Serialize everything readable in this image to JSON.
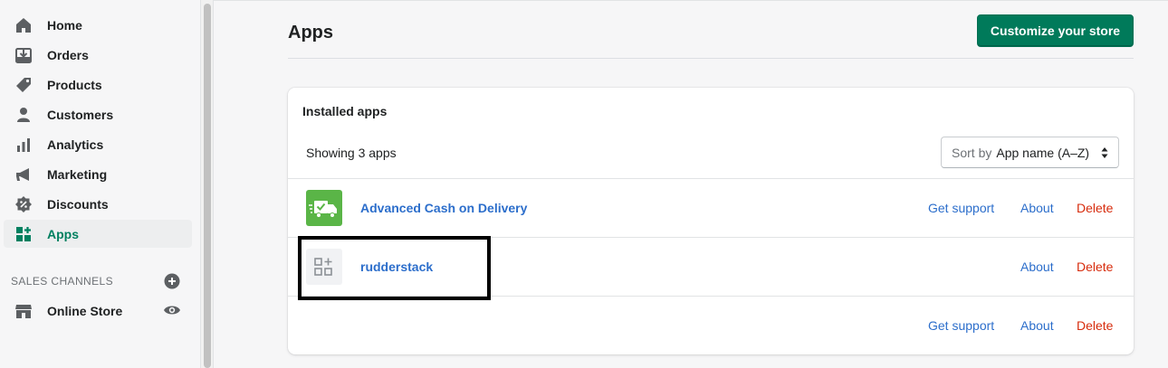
{
  "sidebar": {
    "items": [
      {
        "label": "Home",
        "icon": "home-icon"
      },
      {
        "label": "Orders",
        "icon": "orders-icon"
      },
      {
        "label": "Products",
        "icon": "tag-icon"
      },
      {
        "label": "Customers",
        "icon": "person-icon"
      },
      {
        "label": "Analytics",
        "icon": "bar-chart-icon"
      },
      {
        "label": "Marketing",
        "icon": "megaphone-icon"
      },
      {
        "label": "Discounts",
        "icon": "discount-icon"
      },
      {
        "label": "Apps",
        "icon": "apps-icon",
        "active": true
      }
    ],
    "sales_channels_label": "SALES CHANNELS",
    "channels": [
      {
        "label": "Online Store",
        "icon": "store-icon"
      }
    ]
  },
  "header": {
    "title": "Apps",
    "primary_button": "Customize your store"
  },
  "installed": {
    "title": "Installed apps",
    "showing": "Showing 3 apps",
    "sort_prefix": "Sort by",
    "sort_value": "App name (A–Z)",
    "rows": [
      {
        "name": "Advanced Cash on Delivery",
        "icon": "delivery-truck-icon",
        "get_support": "Get support",
        "about": "About",
        "delete": "Delete"
      },
      {
        "name": "rudderstack",
        "icon": "app-placeholder-icon",
        "about": "About",
        "delete": "Delete"
      },
      {
        "name": "",
        "get_support": "Get support",
        "about": "About",
        "delete": "Delete"
      }
    ]
  },
  "colors": {
    "primary": "#007a5a",
    "link": "#2c6ecb",
    "destructive": "#d72c0d",
    "active_nav": "#008060"
  }
}
